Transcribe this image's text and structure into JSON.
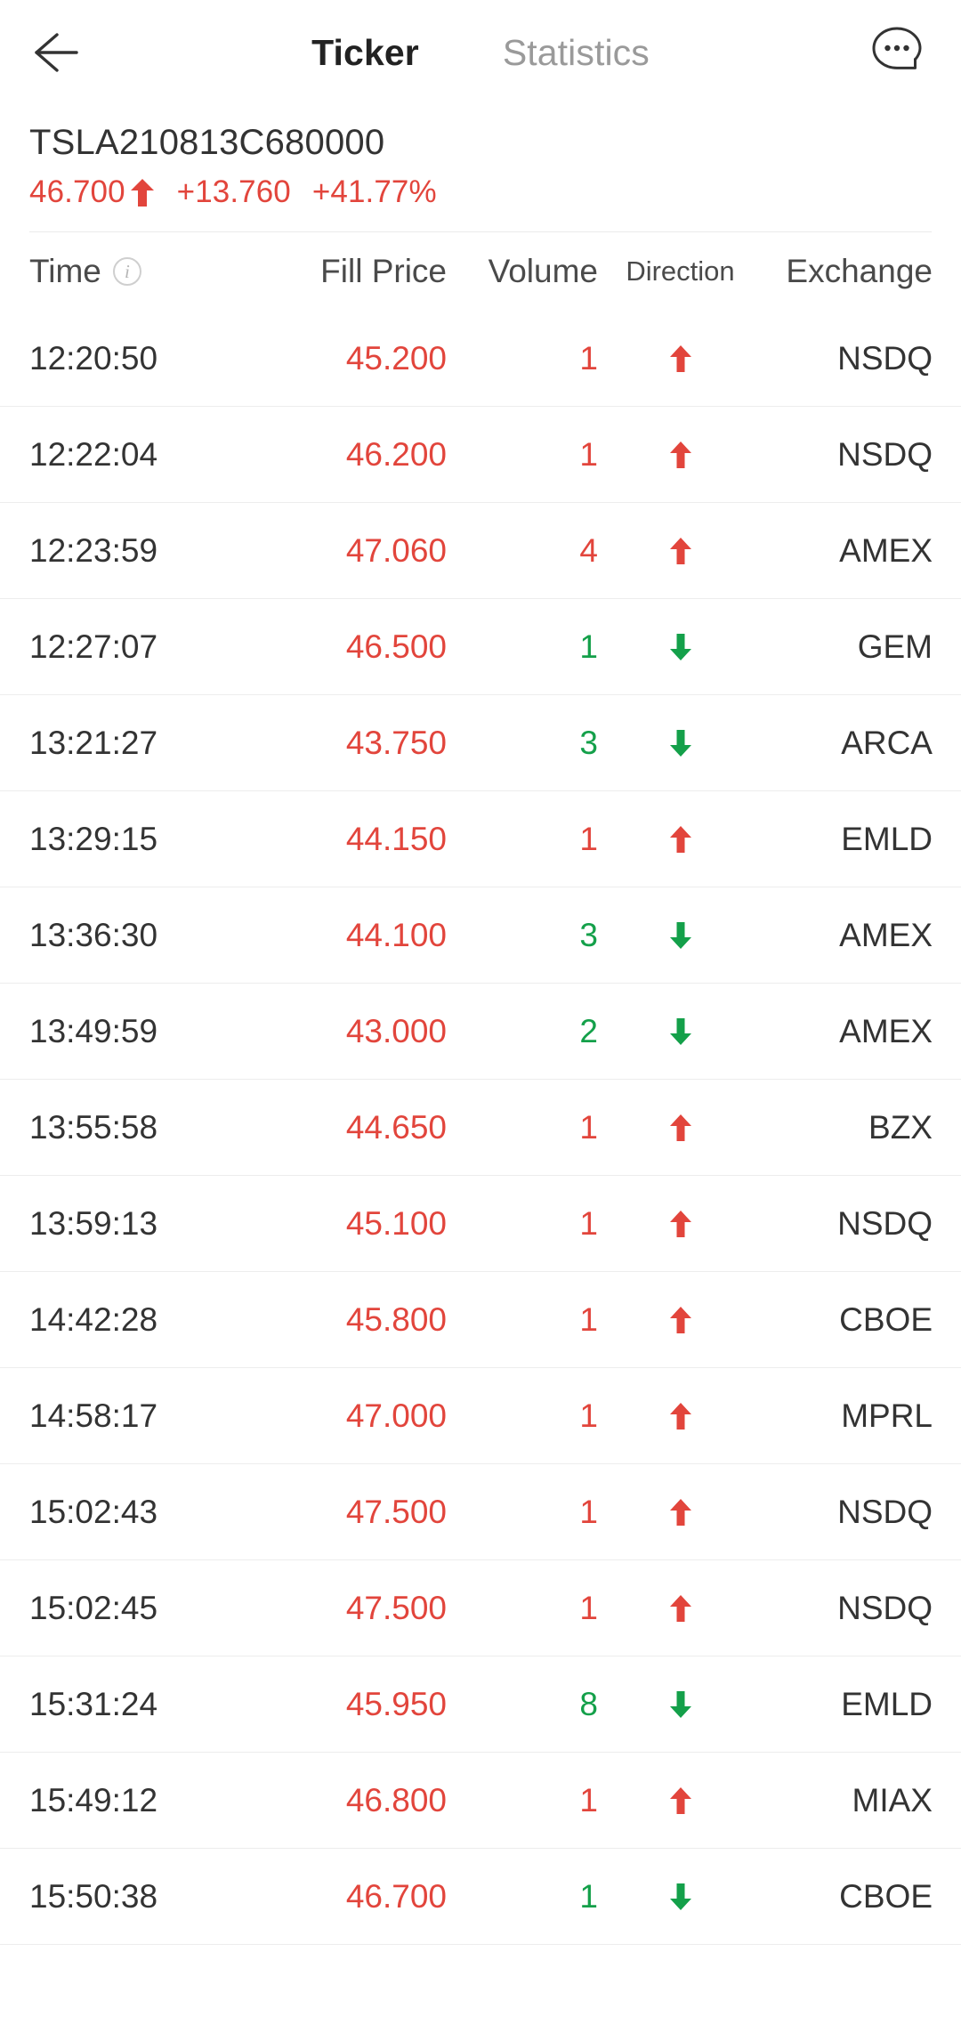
{
  "colors": {
    "up": "#e2453c",
    "down": "#14a04a",
    "text": "#333333",
    "muted": "#9a9a9a",
    "divider": "#ededed"
  },
  "navbar": {
    "back_icon": "arrow-left-icon",
    "tabs": [
      {
        "label": "Ticker",
        "active": true
      },
      {
        "label": "Statistics",
        "active": false
      }
    ],
    "more_icon": "chat-bubble-ellipsis-icon"
  },
  "ticker": {
    "symbol": "TSLA210813C680000",
    "last_price": "46.700",
    "direction": "up",
    "change": "+13.760",
    "change_percent": "+41.77%"
  },
  "table": {
    "headers": {
      "time": "Time",
      "time_info_icon": "info-icon",
      "fill_price": "Fill Price",
      "volume": "Volume",
      "direction": "Direction",
      "exchange": "Exchange"
    },
    "rows": [
      {
        "time": "12:20:50",
        "price": "45.200",
        "volume": "1",
        "direction": "up",
        "exchange": "NSDQ"
      },
      {
        "time": "12:22:04",
        "price": "46.200",
        "volume": "1",
        "direction": "up",
        "exchange": "NSDQ"
      },
      {
        "time": "12:23:59",
        "price": "47.060",
        "volume": "4",
        "direction": "up",
        "exchange": "AMEX"
      },
      {
        "time": "12:27:07",
        "price": "46.500",
        "volume": "1",
        "direction": "down",
        "exchange": "GEM"
      },
      {
        "time": "13:21:27",
        "price": "43.750",
        "volume": "3",
        "direction": "down",
        "exchange": "ARCA"
      },
      {
        "time": "13:29:15",
        "price": "44.150",
        "volume": "1",
        "direction": "up",
        "exchange": "EMLD"
      },
      {
        "time": "13:36:30",
        "price": "44.100",
        "volume": "3",
        "direction": "down",
        "exchange": "AMEX"
      },
      {
        "time": "13:49:59",
        "price": "43.000",
        "volume": "2",
        "direction": "down",
        "exchange": "AMEX"
      },
      {
        "time": "13:55:58",
        "price": "44.650",
        "volume": "1",
        "direction": "up",
        "exchange": "BZX"
      },
      {
        "time": "13:59:13",
        "price": "45.100",
        "volume": "1",
        "direction": "up",
        "exchange": "NSDQ"
      },
      {
        "time": "14:42:28",
        "price": "45.800",
        "volume": "1",
        "direction": "up",
        "exchange": "CBOE"
      },
      {
        "time": "14:58:17",
        "price": "47.000",
        "volume": "1",
        "direction": "up",
        "exchange": "MPRL"
      },
      {
        "time": "15:02:43",
        "price": "47.500",
        "volume": "1",
        "direction": "up",
        "exchange": "NSDQ"
      },
      {
        "time": "15:02:45",
        "price": "47.500",
        "volume": "1",
        "direction": "up",
        "exchange": "NSDQ"
      },
      {
        "time": "15:31:24",
        "price": "45.950",
        "volume": "8",
        "direction": "down",
        "exchange": "EMLD"
      },
      {
        "time": "15:49:12",
        "price": "46.800",
        "volume": "1",
        "direction": "up",
        "exchange": "MIAX"
      },
      {
        "time": "15:50:38",
        "price": "46.700",
        "volume": "1",
        "direction": "down",
        "exchange": "CBOE"
      }
    ]
  }
}
